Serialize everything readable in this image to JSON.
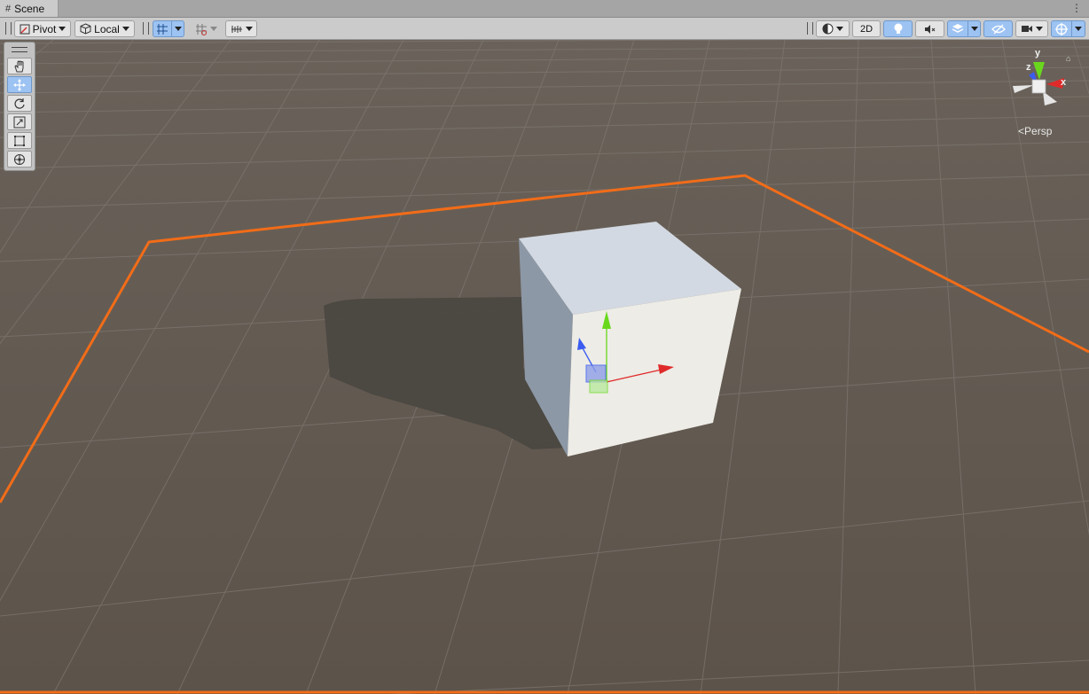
{
  "tab": {
    "title": "Scene",
    "menu_icon": "kebab-menu-icon"
  },
  "toolbar": {
    "pivot_label": "Pivot",
    "local_label": "Local",
    "mode_2d_label": "2D"
  },
  "tools": {
    "items": [
      "hand-tool",
      "move-tool",
      "rotate-tool",
      "scale-tool",
      "rect-tool",
      "transform-tool"
    ],
    "active": "move-tool"
  },
  "gizmo": {
    "axis_y": "y",
    "axis_x": "x",
    "axis_z": "z",
    "projection_label": "Persp"
  },
  "colors": {
    "ground": "#5f564d",
    "grid_line": "#7a7570",
    "selection_outline": "#f26c18",
    "cube_top": "#d3d9e2",
    "cube_left": "#8d98a6",
    "cube_front": "#edece6",
    "axis_x": "#e02a2a",
    "axis_y": "#69d81d",
    "axis_z": "#3a5cf0",
    "active_tool": "#9dc3f3"
  }
}
